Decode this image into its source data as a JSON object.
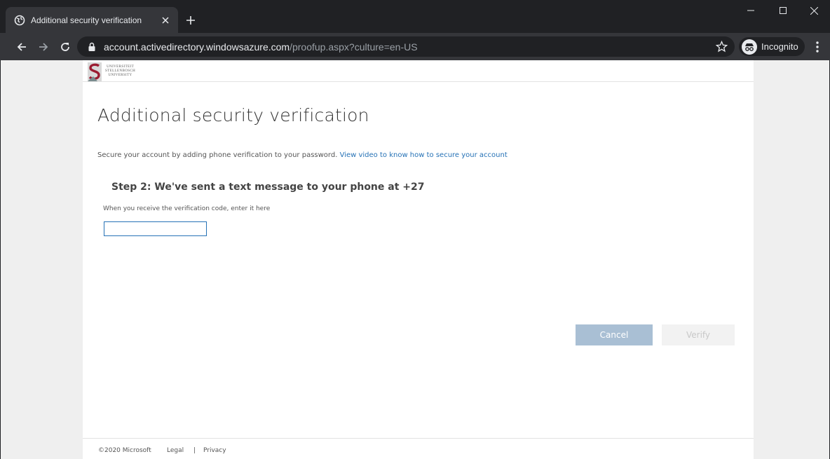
{
  "browser": {
    "tab_title": "Additional security verification",
    "url_host": "account.activedirectory.windowsazure.com",
    "url_path": "/proofup.aspx?culture=en-US",
    "profile_label": "Incognito"
  },
  "org": {
    "logo_lines": [
      "UNIVERSITEIT",
      "STELLENBOSCH",
      "UNIVERSITY"
    ]
  },
  "page": {
    "title": "Additional security verification",
    "intro_text": "Secure your account by adding phone verification to your password.",
    "intro_link": "View video to know how to secure your account",
    "step_heading": "Step 2: We've sent a text message to your phone at +27",
    "hint": "When you receive the verification code, enter it here",
    "code_value": ""
  },
  "actions": {
    "cancel_label": "Cancel",
    "verify_label": "Verify"
  },
  "footer": {
    "copyright": "©2020 Microsoft",
    "legal": "Legal",
    "separator": "|",
    "privacy": "Privacy"
  },
  "colors": {
    "link": "#2672b6",
    "cancel_bg": "#a9bfd4",
    "logo_red": "#9b1c31"
  }
}
